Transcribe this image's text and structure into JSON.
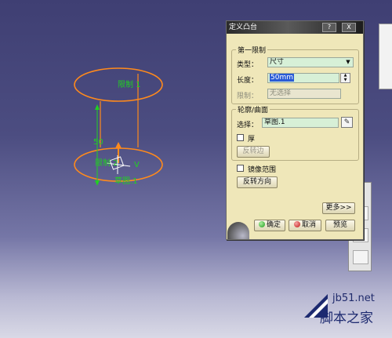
{
  "viewport": {
    "limit1_label": "限制 1",
    "limit2_label": "限制 2",
    "dim_value": "50",
    "axis_v_label": "V",
    "sketch_label": "草图.1"
  },
  "dialog": {
    "title": "定义凸台",
    "title_help": "?",
    "title_close": "X",
    "first_limit": {
      "group_label": "第一限制",
      "type_label": "类型：",
      "type_value": "尺寸",
      "length_label": "长度：",
      "length_value": "50mm",
      "limit_label": "限制：",
      "limit_value": "无选择"
    },
    "profile": {
      "group_label": "轮廓/曲面",
      "selection_label": "选择：",
      "selection_value": "草图.1",
      "thick_label": "厚",
      "reverse_side_label": "反转边"
    },
    "mirror_label": "镜像范围",
    "reverse_direction_label": "反转方向",
    "more_label": "更多>>",
    "ok_label": "确定",
    "cancel_label": "取消",
    "preview_label": "预览"
  },
  "watermark": {
    "url": "jb51.net",
    "name": "脚本之家"
  },
  "colors": {
    "background_top": "#3f3f73",
    "background_bottom": "#d9d9e6",
    "dialog_bg": "#efe7b9",
    "geometry_orange": "#ff8a1c",
    "label_green": "#22d022",
    "field_green": "#d7f0d7"
  }
}
